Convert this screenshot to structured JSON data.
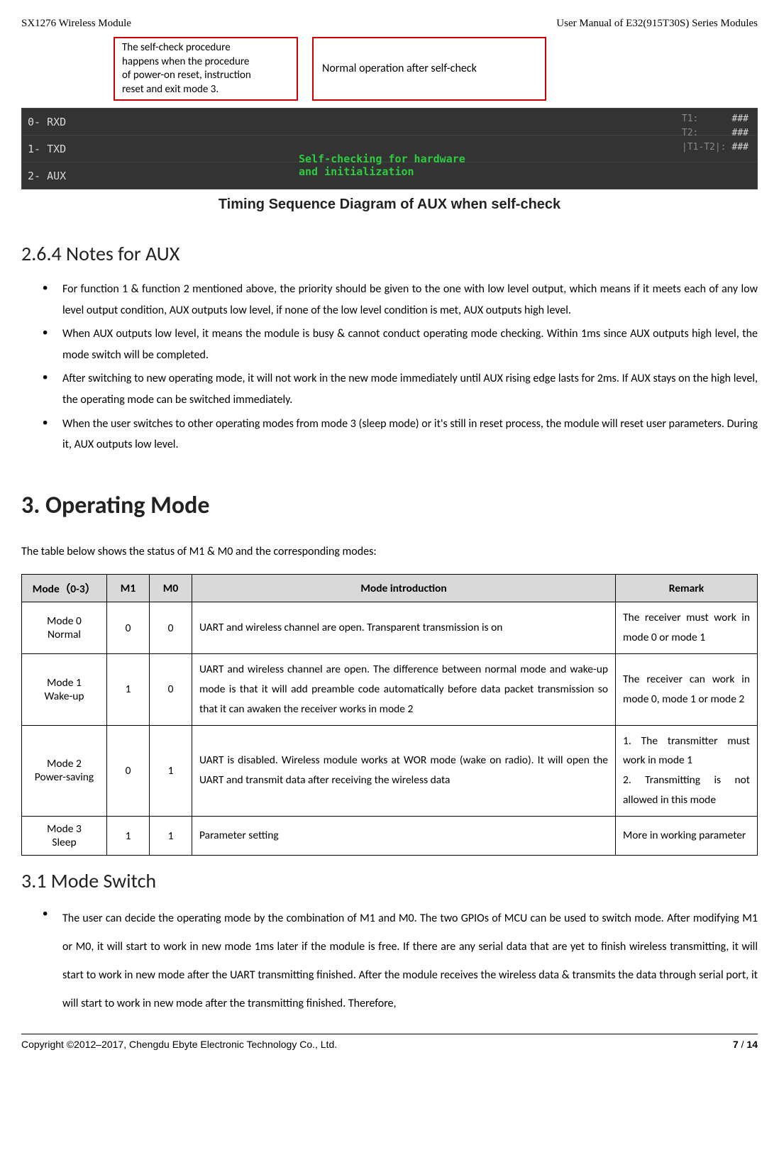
{
  "header": {
    "left": "SX1276 Wireless Module",
    "right": "User Manual of E32(915T30S) Series Modules"
  },
  "diagram": {
    "callout_a_line1": "The self-check procedure",
    "callout_a_line2": "happens when the procedure",
    "callout_a_line3": "of power-on reset, instruction",
    "callout_a_line4": "reset and exit mode 3.",
    "callout_b": "Normal operation after self-check",
    "row0": "0-  RXD",
    "row1": "1-  TXD",
    "row2": "2-  AUX",
    "t_label0": "T1:",
    "t_label1": "T2:",
    "t_label2": "|T1-T2|:",
    "hash": "###",
    "selfcheck_line1": "Self-checking for hardware",
    "selfcheck_line2": "and initialization",
    "title": "Timing Sequence Diagram of AUX when self-check"
  },
  "s264": {
    "heading": "2.6.4 Notes for AUX",
    "b1": "For function 1 & function 2 mentioned above, the priority should be given to the one with low level output, which means if it meets each of any low level output condition, AUX outputs low level, if none of the low level condition is met, AUX outputs high level.",
    "b2": "When AUX outputs low level, it means the module is busy & cannot conduct operating mode checking. Within 1ms since AUX outputs high level, the mode switch will be completed.",
    "b3": "After switching to new operating mode, it will not work in the new mode immediately until AUX rising edge lasts for 2ms. If AUX stays on the high level, the operating mode can be switched immediately.",
    "b4": "When the user switches to other operating modes from mode 3 (sleep mode) or it's still in reset process, the module will reset user parameters. During it, AUX outputs low level."
  },
  "s3": {
    "heading": "3.  Operating Mode",
    "intro": "The table below shows the status of M1 & M0 and the corresponding modes: "
  },
  "table": {
    "h0": "Mode（0-3）",
    "h1": "M1",
    "h2": "M0",
    "h3": "Mode introduction",
    "h4": "Remark",
    "rows": [
      {
        "c0a": "Mode 0",
        "c0b": "Normal",
        "c1": "0",
        "c2": "0",
        "c3": "UART and wireless channel are open. Transparent transmission is on",
        "c4": "The receiver must work in mode 0 or mode 1"
      },
      {
        "c0a": "Mode 1",
        "c0b": "Wake-up",
        "c1": "1",
        "c2": "0",
        "c3": "UART and wireless channel are open. The difference between normal mode and wake-up mode is that it will add preamble code automatically before data packet transmission so that it can awaken the receiver works in mode 2",
        "c4": "The receiver can work in mode 0, mode 1 or mode 2"
      },
      {
        "c0a": "Mode 2",
        "c0b": "Power-saving",
        "c1": "0",
        "c2": "1",
        "c3": "UART is disabled. Wireless module works at WOR mode (wake on radio). It will open the UART and transmit data after receiving the wireless data",
        "c4": "1.  The  transmitter  must work in mode 1\n2.  Transmitting  is  not allowed in this mode"
      },
      {
        "c0a": "Mode 3",
        "c0b": "Sleep",
        "c1": "1",
        "c2": "1",
        "c3": "Parameter setting",
        "c4": "More in working parameter"
      }
    ]
  },
  "s31": {
    "heading": "3.1 Mode Switch",
    "b1": "The user can decide the operating mode by the combination of M1 and M0. The two GPIOs of MCU can be used to switch mode. After modifying M1 or M0, it will start to work in new mode 1ms later if the module is free. If there are any serial data that are yet to finish wireless transmitting, it will start to work in new mode after the UART transmitting finished. After the module receives the wireless data & transmits the data through serial port, it will start to work in new mode after the transmitting finished. Therefore,"
  },
  "footer": {
    "left": "Copyright ©2012–2017, Chengdu Ebyte Electronic Technology Co., Ltd.",
    "right_page": "7",
    "right_sep": " / ",
    "right_total": "14"
  }
}
